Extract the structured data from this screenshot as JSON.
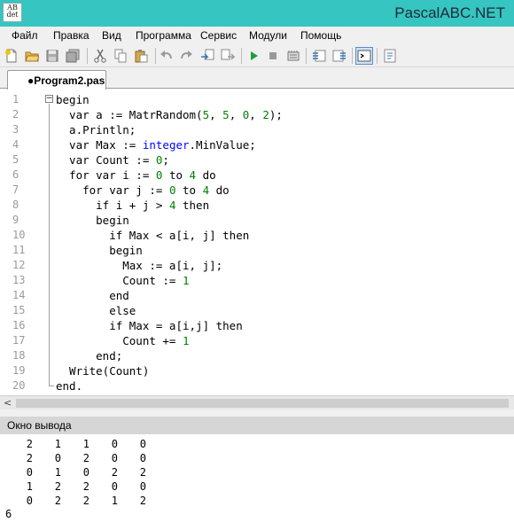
{
  "window": {
    "title": "PascalABC.NET",
    "icon_text": [
      "AB",
      "det"
    ]
  },
  "menu": [
    "Файл",
    "Правка",
    "Вид",
    "Программа",
    "Сервис",
    "Модули",
    "Помощь"
  ],
  "toolbar_icons": [
    "new-file-icon",
    "open-file-icon",
    "save-icon",
    "save-all-icon",
    "cut-icon",
    "copy-icon",
    "paste-icon",
    "undo-icon",
    "redo-icon",
    "find-icon",
    "replace-icon",
    "run-icon",
    "stop-icon",
    "compile-icon",
    "debug-step-icon",
    "debug-step-over-icon",
    "output-window-icon",
    "form-designer-icon"
  ],
  "tab": {
    "label": "●Program2.pas"
  },
  "editor": {
    "line_numbers": [
      "1",
      "2",
      "3",
      "4",
      "5",
      "6",
      "7",
      "8",
      "9",
      "10",
      "11",
      "12",
      "13",
      "14",
      "15",
      "16",
      "17",
      "18",
      "19",
      "20"
    ],
    "lines": [
      "begin",
      "  var a := MatrRandom(5, 5, 0, 2);",
      "  a.Println;",
      "  var Max := integer.MinValue;",
      "  var Count := 0;",
      "  for var i := 0 to 4 do",
      "    for var j := 0 to 4 do",
      "      if i + j > 4 then",
      "      begin",
      "        if Max < a[i, j] then",
      "        begin",
      "          Max := a[i, j];",
      "          Count := 1",
      "        end",
      "        else",
      "        if Max = a[i,j] then",
      "          Count += 1",
      "      end;",
      "  Write(Count)",
      "end."
    ]
  },
  "output": {
    "title": "Окно вывода",
    "matrix": [
      [
        "2",
        "1",
        "1",
        "0",
        "0"
      ],
      [
        "2",
        "0",
        "2",
        "0",
        "0"
      ],
      [
        "0",
        "1",
        "0",
        "2",
        "2"
      ],
      [
        "1",
        "2",
        "2",
        "0",
        "0"
      ],
      [
        "0",
        "2",
        "2",
        "1",
        "2"
      ]
    ],
    "result": "6"
  },
  "colors": {
    "titlebar": "#36c5c0",
    "keyword_number": "#008000",
    "keyword_type": "#0000ff"
  }
}
